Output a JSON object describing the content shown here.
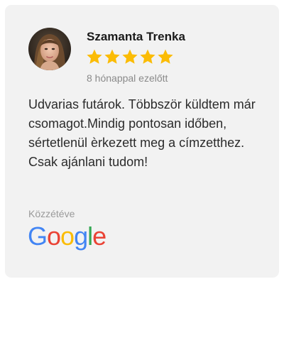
{
  "review": {
    "author": "Szamanta Trenka",
    "rating": 5,
    "rating_max": 5,
    "time_ago": "8 hónappal ezelőtt",
    "text": "Udvarias futárok. Többször küldtem már csomagot.Mindig pontosan időben, sértetlenül èrkezett meg a címzetthez. Csak ajánlani tudom!",
    "posted_label": "Közzétéve",
    "platform": "Google"
  },
  "colors": {
    "card_background": "#f2f2f2",
    "star": "#fbbc05",
    "google_blue": "#4285f4",
    "google_red": "#ea4335",
    "google_yellow": "#fbbc05",
    "google_green": "#34a853"
  },
  "icons": {
    "avatar": "user-avatar-photo",
    "star": "star-icon",
    "platform_logo": "google-logo"
  }
}
